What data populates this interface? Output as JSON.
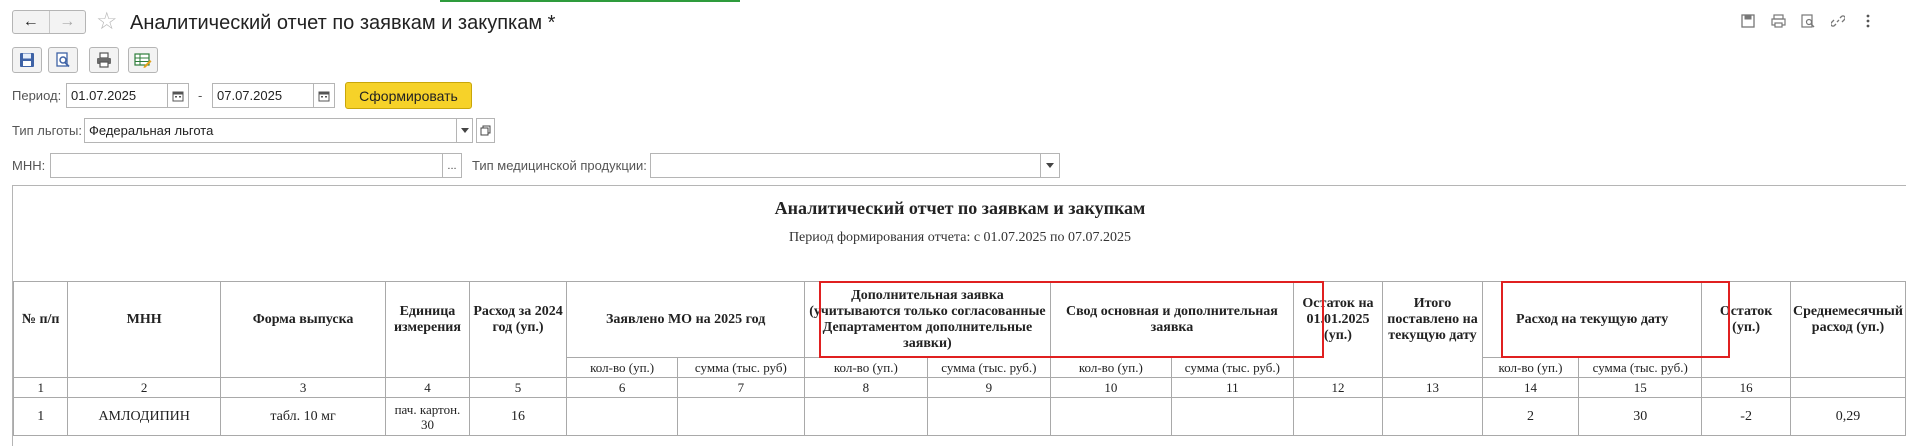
{
  "window": {
    "title": "Аналитический отчет по заявкам и закупкам *",
    "back_icon": "←",
    "forward_icon": "→",
    "star_icon": "☆"
  },
  "filters": {
    "period_label": "Период:",
    "date_from": "01.07.2025",
    "date_to": "07.07.2025",
    "dash": "-",
    "generate_label": "Сформировать",
    "benefit_label": "Тип льготы:",
    "benefit_value": "Федеральная льгота",
    "mnn_label": "МНН:",
    "mnn_value": "",
    "mnn_picker": "...",
    "product_type_label": "Тип медицинской продукции:",
    "product_type_value": ""
  },
  "report": {
    "title": "Аналитический отчет по заявкам и закупкам",
    "subtitle": "Период формирования отчета: с 01.07.2025 по 07.07.2025",
    "headers": {
      "num": "№ п/п",
      "mnn": "МНН",
      "form": "Форма выпуска",
      "unit": "Единица измерения",
      "spent2024": "Расход за 2024 год (уп.)",
      "declared": "Заявлено МО на 2025 год",
      "additional": "Дополнительная заявка (учитываются только согласованные Департаментом дополнительные заявки)",
      "summary": "Свод основная и дополнительная заявка",
      "balance0101": "Остаток на 01.01.2025 (уп.)",
      "delivered": "Итого поставлено на текущую дату",
      "spent_current": "Расход на текущую дату",
      "balance": "Остаток (уп.)",
      "avg": "Среднемесячный расход (уп.)"
    },
    "sub": {
      "qty": "кол-во (уп.)",
      "sum": "сумма (тыс. руб)",
      "sum2": "сумма (тыс. руб.)"
    },
    "colnums": [
      "1",
      "2",
      "3",
      "4",
      "5",
      "6",
      "7",
      "8",
      "9",
      "10",
      "11",
      "12",
      "13",
      "14",
      "15",
      "16"
    ],
    "rows": [
      {
        "num": "1",
        "mnn": "АМЛОДИПИН",
        "form": "табл. 10 мг",
        "unit": "пач. картон. 30",
        "spent2024": "16",
        "declared_qty": "",
        "declared_sum": "",
        "additional_qty": "",
        "additional_sum": "",
        "summary_qty": "",
        "summary_sum": "",
        "balance0101": "",
        "delivered": "",
        "spent_qty": "2",
        "spent_sum": "30",
        "balance": "-2",
        "avg": "0,29"
      }
    ]
  }
}
